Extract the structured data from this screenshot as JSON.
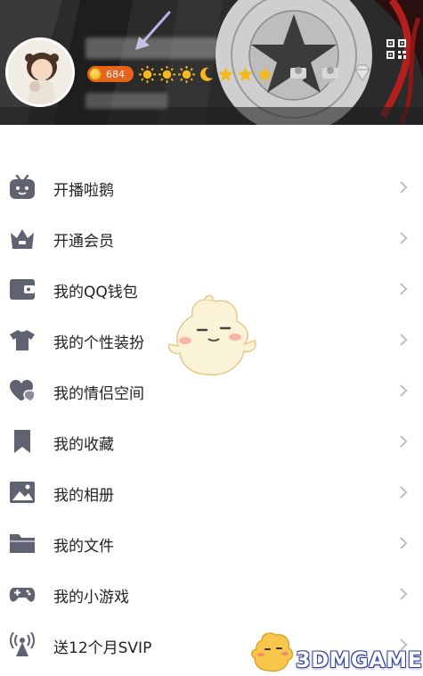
{
  "profile": {
    "coin_count": "684",
    "qr_code_icon": "qr-code-icon",
    "level_badges": [
      "sun",
      "sun",
      "sun",
      "moon",
      "star",
      "star",
      "star"
    ],
    "vip_badges": [
      "vip-badge-icon",
      "vip-badge-icon",
      "diamond-icon"
    ]
  },
  "menu": {
    "items": [
      {
        "label": "开播啦鹅",
        "icon": "tv-icon"
      },
      {
        "label": "开通会员",
        "icon": "crown-icon"
      },
      {
        "label": "我的QQ钱包",
        "icon": "wallet-icon"
      },
      {
        "label": "我的个性装扮",
        "icon": "tshirt-icon"
      },
      {
        "label": "我的情侣空间",
        "icon": "heart-icon"
      },
      {
        "label": "我的收藏",
        "icon": "bookmark-icon"
      },
      {
        "label": "我的相册",
        "icon": "photo-icon"
      },
      {
        "label": "我的文件",
        "icon": "folder-icon"
      },
      {
        "label": "我的小游戏",
        "icon": "gamepad-icon"
      },
      {
        "label": "送12个月SVIP",
        "icon": "broadcast-icon"
      }
    ]
  },
  "watermark": {
    "text": "3DMGAME"
  },
  "colors": {
    "icon_gray": "#5f6270",
    "coin_badge": "#e9621a",
    "sun_badge": "#f6b81a",
    "watermark_outline": "#2a3ea8"
  }
}
